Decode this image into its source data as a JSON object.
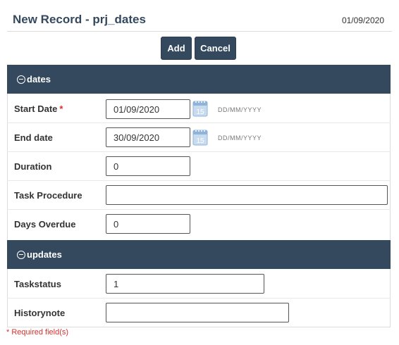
{
  "header": {
    "title": "New Record - prj_dates",
    "date": "01/09/2020"
  },
  "toolbar": {
    "add_label": "Add",
    "cancel_label": "Cancel"
  },
  "sections": {
    "dates": {
      "title": "dates",
      "fields": {
        "start_date": {
          "label": "Start Date",
          "required_marker": "*",
          "value": "01/09/2020",
          "format_hint": "DD/MM/YYYY"
        },
        "end_date": {
          "label": "End date",
          "value": "30/09/2020",
          "format_hint": "DD/MM/YYYY"
        },
        "duration": {
          "label": "Duration",
          "value": "0"
        },
        "task_procedure": {
          "label": "Task Procedure",
          "value": ""
        },
        "days_overdue": {
          "label": "Days Overdue",
          "value": "0"
        }
      }
    },
    "updates": {
      "title": "updates",
      "fields": {
        "taskstatus": {
          "label": "Taskstatus",
          "value": "1"
        },
        "historynote": {
          "label": "Historynote",
          "value": ""
        }
      }
    }
  },
  "footer": {
    "required_note": "* Required field(s)"
  },
  "icons": {
    "calendar": "calendar-icon",
    "section_toggle": "collapse-circle-minus-icon"
  },
  "colors": {
    "header_bar": "#34495e",
    "button": "#34495e",
    "required": "#d9302c",
    "calendar_icon": "#8fb3d9"
  }
}
